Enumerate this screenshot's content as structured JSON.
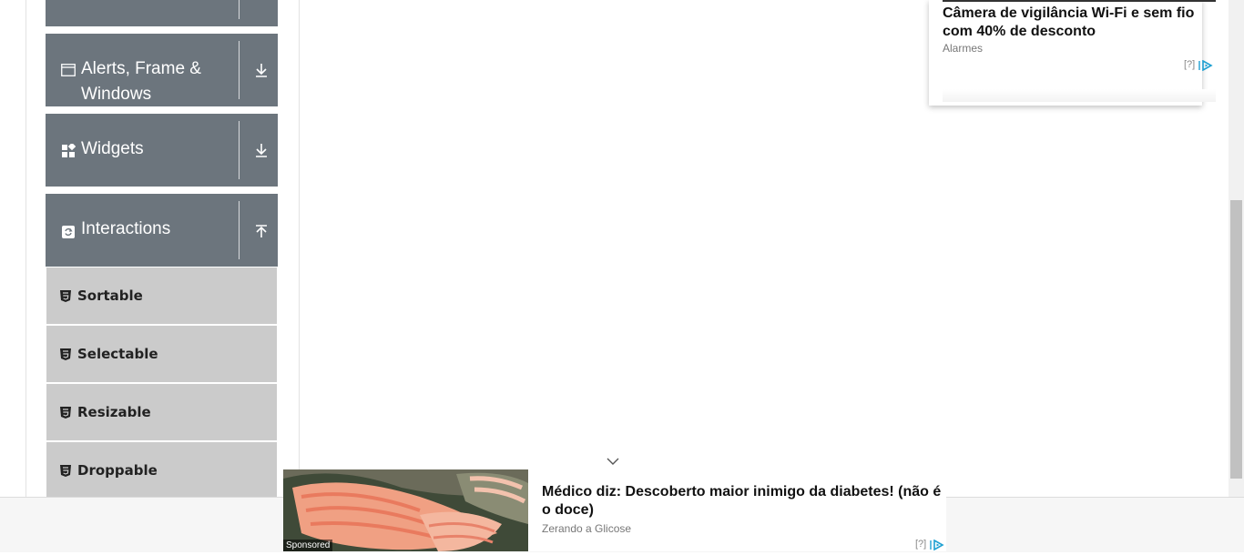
{
  "sidebar": {
    "groups": [
      {
        "label": "Alerts, Frame & Windows",
        "icon": "window-icon",
        "arrow": "download-arrow-icon"
      },
      {
        "label": "Widgets",
        "icon": "widgets-icon",
        "arrow": "download-arrow-icon"
      },
      {
        "label": "Interactions",
        "icon": "refresh-icon",
        "arrow": "upload-arrow-icon"
      }
    ],
    "items": [
      {
        "label": "Sortable",
        "icon": "html5-icon"
      },
      {
        "label": "Selectable",
        "icon": "html5-icon"
      },
      {
        "label": "Resizable",
        "icon": "html5-icon"
      },
      {
        "label": "Droppable",
        "icon": "html5-icon"
      }
    ]
  },
  "ad_top": {
    "headline": "Câmera de vigilância Wi-Fi e sem fio com 40% de desconto",
    "source": "Alarmes",
    "info": "[?]"
  },
  "ad_bottom": {
    "headline": "Médico diz: Descoberto maior inimigo da diabetes! (não é o doce)",
    "source": "Zerando a Glicose",
    "sponsored": "Sponsored",
    "info": "[?]"
  },
  "colors": {
    "group_bg": "#6c757d",
    "item_bg": "#cbcbcb",
    "adchoices_blue": "#1ea0d2"
  }
}
